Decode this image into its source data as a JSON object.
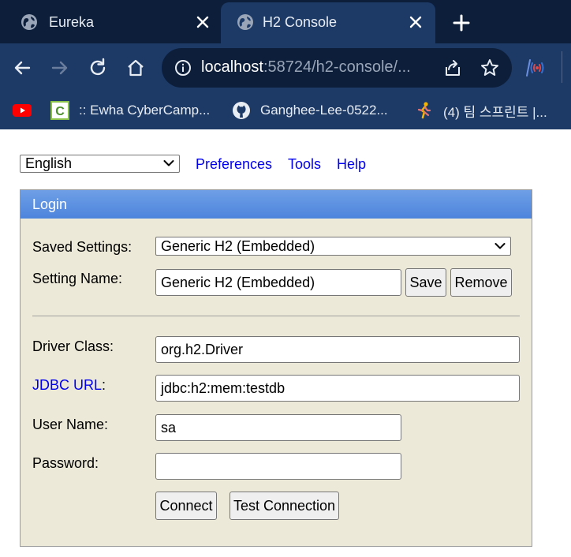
{
  "browser": {
    "tabs": [
      {
        "title": "Eureka",
        "active": false
      },
      {
        "title": "H2 Console",
        "active": true
      }
    ],
    "address": {
      "host": "localhost",
      "rest": ":58724/h2-console/..."
    },
    "bookmarks": [
      {
        "label": "",
        "icon": "youtube-icon"
      },
      {
        "label": ":: Ewha CyberCamp...",
        "icon": "cybercamp-icon"
      },
      {
        "label": "Ganghee-Lee-0522...",
        "icon": "github-icon"
      },
      {
        "label": "(4) 팀 스프린트 |...",
        "icon": "runner-icon"
      }
    ],
    "colors": {
      "tab_strip": "#0c1e3a",
      "toolbar": "#1d3a66"
    }
  },
  "top": {
    "language": "English",
    "links": {
      "preferences": "Preferences",
      "tools": "Tools",
      "help": "Help"
    }
  },
  "login": {
    "header": "Login",
    "saved_settings_label": "Saved Settings:",
    "saved_settings_value": "Generic H2 (Embedded)",
    "setting_name_label": "Setting Name:",
    "setting_name_value": "Generic H2 (Embedded)",
    "save_label": "Save",
    "remove_label": "Remove",
    "driver_class_label": "Driver Class:",
    "driver_class_value": "org.h2.Driver",
    "jdbc_url_link": "JDBC URL",
    "jdbc_url_colon": ":",
    "jdbc_url_value": "jdbc:h2:mem:testdb",
    "user_name_label": "User Name:",
    "user_name_value": "sa",
    "password_label": "Password:",
    "password_value": "",
    "connect_label": "Connect",
    "test_connection_label": "Test Connection",
    "colors": {
      "header": "#5b8fe0",
      "panel": "#ece9d8",
      "link": "#0000ee"
    }
  }
}
